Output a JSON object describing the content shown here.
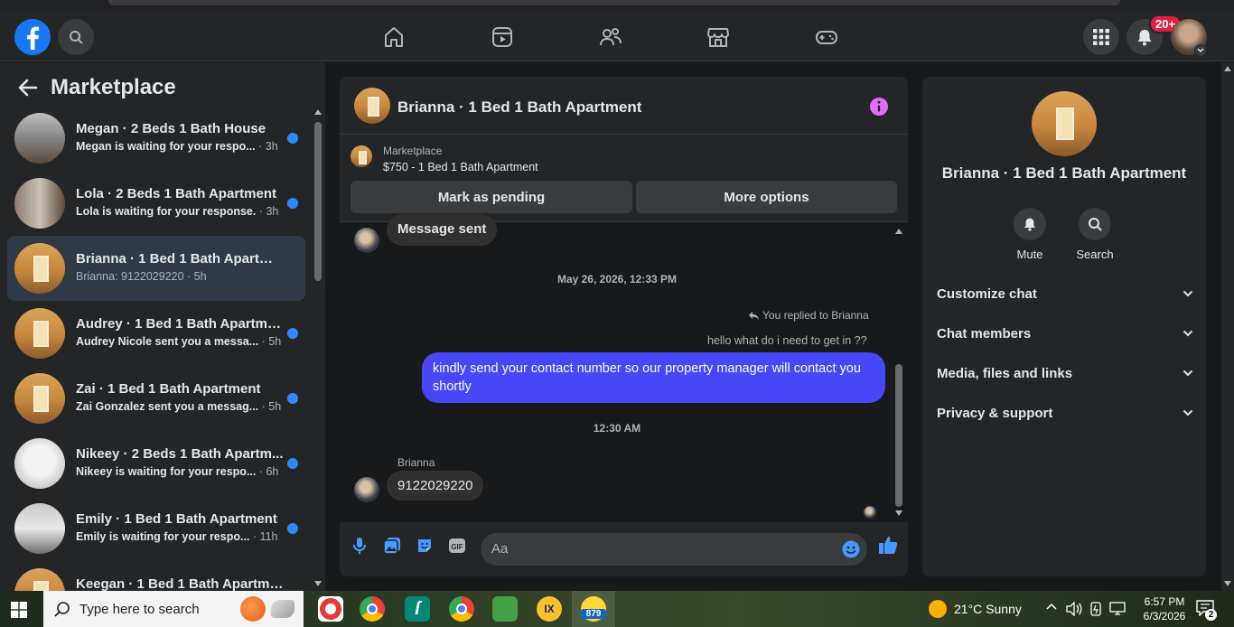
{
  "notifications_badge": "20+",
  "sidebar": {
    "title": "Marketplace",
    "items": [
      {
        "name": "Megan · 2 Beds 1 Bath House",
        "preview": "Megan is waiting for your respo...",
        "time": "· 3h",
        "unread": true,
        "thumb": "house1"
      },
      {
        "name": "Lola · 2 Beds 1 Bath Apartment",
        "preview": "Lola is waiting for your response.",
        "time": "· 3h",
        "unread": true,
        "thumb": "house2"
      },
      {
        "name": "Brianna · 1 Bed 1 Bath Apartment",
        "preview": "Brianna: 9122029220",
        "time": "· 5h",
        "unread": false,
        "thumb": "apt"
      },
      {
        "name": "Audrey · 1 Bed 1 Bath Apartment",
        "preview": "Audrey Nicole sent you a messa...",
        "time": "· 5h",
        "unread": true,
        "thumb": "apt"
      },
      {
        "name": "Zai · 1 Bed 1 Bath Apartment",
        "preview": "Zai Gonzalez sent you a messag...",
        "time": "· 5h",
        "unread": true,
        "thumb": "apt"
      },
      {
        "name": "Nikeey · 2 Beds 1 Bath Apartm...",
        "preview": "Nikeey is waiting for your respo...",
        "time": "· 6h",
        "unread": true,
        "thumb": "white-room"
      },
      {
        "name": "Emily · 1 Bed 1 Bath Apartment",
        "preview": "Emily is waiting for your respo...",
        "time": "· 11h",
        "unread": true,
        "thumb": "kitchen"
      },
      {
        "name": "Keegan · 1 Bed 1 Bath Apartme...",
        "preview": "",
        "time": "",
        "unread": false,
        "thumb": "apt"
      }
    ]
  },
  "chat": {
    "title": "Brianna · 1 Bed 1 Bath Apartment",
    "marketplace_label": "Marketplace",
    "listing": "$750 - 1 Bed 1 Bath Apartment",
    "mark_pending_label": "Mark as pending",
    "more_options_label": "More options",
    "msg_sent": "Message sent",
    "timestamp1": "May 26, 2026, 12:33 PM",
    "replied_to": "You replied to Brianna",
    "quoted": "hello what do i need to get in ??",
    "outgoing": "kindly send your contact number so our property manager will contact you shortly",
    "timestamp2": "12:30 AM",
    "sender_name": "Brianna",
    "incoming": "9122029220",
    "input_placeholder": "Aa"
  },
  "panel": {
    "title": "Brianna · 1 Bed 1 Bath Apartment",
    "mute_label": "Mute",
    "search_label": "Search",
    "rows": [
      "Customize chat",
      "Chat members",
      "Media, files and links",
      "Privacy & support"
    ]
  },
  "taskbar": {
    "search_placeholder": "Type here to search",
    "weather": "21°C  Sunny",
    "time": "6:57 PM",
    "date": "6/3/2026",
    "notif_count": "2",
    "app_badge": "879"
  },
  "colors": {
    "accent": "#1877f2",
    "outgoing_bubble": "#4747f7",
    "unread_dot": "#2e89ff",
    "info_icon": "#e36dfb"
  }
}
